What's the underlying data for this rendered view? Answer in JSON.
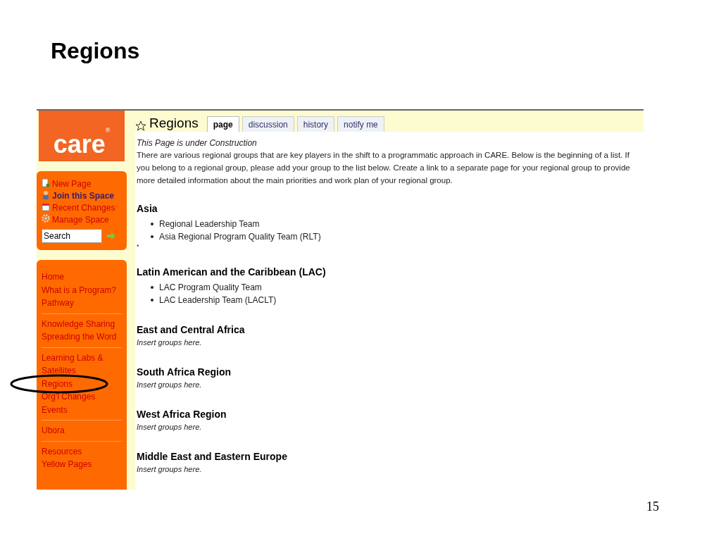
{
  "slide": {
    "title": "Regions",
    "page_number": "15"
  },
  "sidebar": {
    "logo_text": "care",
    "logo_mark": "®",
    "actions": [
      {
        "label": "New Page",
        "kind": "page",
        "bold": false
      },
      {
        "label": "Join this Space",
        "kind": "person",
        "bold": true
      },
      {
        "label": "Recent Changes",
        "kind": "calendar",
        "bold": false
      },
      {
        "label": "Manage Space",
        "kind": "gear",
        "bold": false
      }
    ],
    "search": {
      "value": "Search"
    },
    "nav_groups": [
      [
        {
          "label": "Home",
          "highlighted": false
        },
        {
          "label": "What is a Program?",
          "highlighted": false
        },
        {
          "label": "Pathway",
          "highlighted": false
        }
      ],
      [
        {
          "label": "Knowledge Sharing",
          "highlighted": false
        },
        {
          "label": "Spreading the Word",
          "highlighted": false
        }
      ],
      [
        {
          "label": "Learning Labs & Satellites",
          "highlighted": false
        },
        {
          "label": "Regions",
          "highlighted": true
        },
        {
          "label": "Org'l Changes",
          "highlighted": false
        },
        {
          "label": "Events",
          "highlighted": false
        }
      ],
      [
        {
          "label": "Ubora",
          "highlighted": false
        }
      ],
      [
        {
          "label": "Resources",
          "highlighted": false
        },
        {
          "label": "Yellow Pages",
          "highlighted": false
        }
      ]
    ]
  },
  "page": {
    "title": "Regions",
    "tabs": [
      {
        "label": "page",
        "selected": true
      },
      {
        "label": "discussion",
        "selected": false
      },
      {
        "label": "history",
        "selected": false
      },
      {
        "label": "notify me",
        "selected": false
      }
    ],
    "notice": "This Page is under Construction",
    "intro": "There are various regional groups that are key players in the shift to a programmatic approach in CARE. Below is the beginning of a list. If you belong to a regional group, please add your group to the list below. Create a link to a separate page for your regional group to provide more detailed information about the main priorities and work plan of your regional group.",
    "sections": [
      {
        "heading": "Asia",
        "items": [
          "Regional Leadership Team",
          "Asia Regional Program Quality Team (RLT)"
        ],
        "trailing": "*"
      },
      {
        "heading": "Latin American and the Caribbean (LAC)",
        "items": [
          "LAC Program Quality Team",
          "LAC Leadership Team (LACLT)"
        ]
      },
      {
        "heading": "East and Central Africa",
        "note": "Insert groups here."
      },
      {
        "heading": "South Africa Region",
        "note": "Insert groups here."
      },
      {
        "heading": "West Africa Region",
        "note": "Insert groups here."
      },
      {
        "heading": "Middle East and Eastern Europe",
        "note": "Insert groups here."
      }
    ]
  }
}
